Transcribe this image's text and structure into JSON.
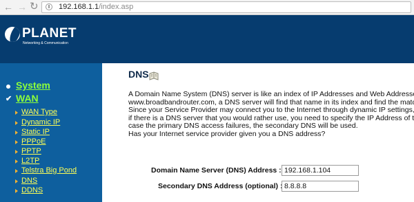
{
  "browser": {
    "url_host": "192.168.1.1",
    "url_path": "/index.asp",
    "back_glyph": "←",
    "forward_glyph": "→",
    "reload_glyph": "↻"
  },
  "brand": {
    "name": "PLANET",
    "tagline": "Networking & Communication"
  },
  "sidebar": {
    "system_label": "System",
    "wan_label": "WAN",
    "wan_items": [
      {
        "label": "WAN Type"
      },
      {
        "label": "Dynamic IP"
      },
      {
        "label": "Static IP"
      },
      {
        "label": "PPPoE"
      },
      {
        "label": "PPTP"
      },
      {
        "label": "L2TP"
      },
      {
        "label": "Telstra Big Pond"
      },
      {
        "label": "DNS"
      },
      {
        "label": "DDNS"
      }
    ]
  },
  "content": {
    "title": "DNS",
    "intro_lines": [
      "A Domain Name System (DNS) server is like an index of IP Addresses and Web Addresses.",
      "www.broadbandrouter.com, a DNS server will find that name in its index and find the matchin",
      "Since your Service Provider may connect you to the Internet through dynamic IP settings, it i",
      "if there is a DNS server that you would rather use, you need to specify the IP Address of that",
      "case the primary DNS access failures, the secondary DNS will be used.",
      "Has your Internet service provider given you a DNS address?"
    ],
    "primary_dns": {
      "label": "Domain Name Server (DNS) Address :",
      "value": "192.168.1.104"
    },
    "secondary_dns": {
      "label": "Secondary DNS Address (optional) :",
      "value": "8.8.8.8"
    }
  },
  "colors": {
    "header_bg": "#063c6f",
    "sidebar_bg": "#0e5f9e",
    "main_link": "#8cff3a",
    "sub_link": "#ffff55"
  }
}
